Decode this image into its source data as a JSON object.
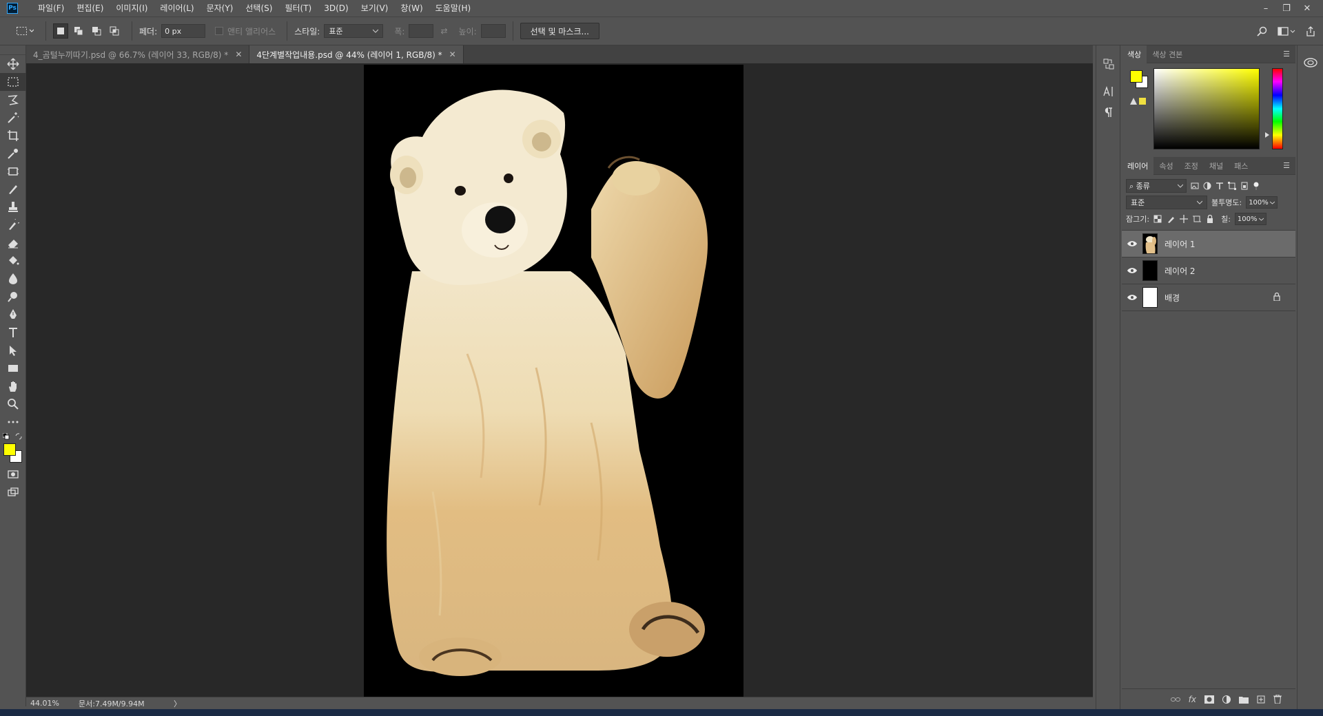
{
  "app": {
    "logo": "Ps"
  },
  "menu": [
    "파일(F)",
    "편집(E)",
    "이미지(I)",
    "레이어(L)",
    "문자(Y)",
    "선택(S)",
    "필터(T)",
    "3D(D)",
    "보기(V)",
    "창(W)",
    "도움말(H)"
  ],
  "window_controls": {
    "minimize": "–",
    "restore": "❐",
    "close": "✕"
  },
  "options": {
    "feather_label": "페더:",
    "feather_value": "0 px",
    "antialias_label": "앤티 앨리어스",
    "style_label": "스타일:",
    "style_value": "표준",
    "width_label": "폭:",
    "height_label": "높이:",
    "select_mask_button": "선택 및 마스크..."
  },
  "tabs": [
    {
      "label": "4_곰털누끼따기.psd @ 66.7% (레이어 33, RGB/8) *",
      "active": false
    },
    {
      "label": "4단계별작업내용.psd @ 44% (레이어 1, RGB/8) *",
      "active": true
    }
  ],
  "status": {
    "zoom": "44.01%",
    "doc": "문서:7.49M/9.94M",
    "arrow": "〉"
  },
  "color_panel": {
    "tabs": [
      "색상",
      "색상 견본"
    ],
    "foreground": "#ffff00",
    "background": "#ffffff"
  },
  "layers_panel": {
    "tabs": [
      "레이어",
      "속성",
      "조정",
      "채널",
      "패스"
    ],
    "filter_label": "종류",
    "blend_mode": "표준",
    "opacity_label": "불투명도:",
    "opacity_value": "100%",
    "lock_label": "잠그기:",
    "fill_label": "칠:",
    "fill_value": "100%",
    "layers": [
      {
        "name": "레이어 1",
        "selected": true,
        "thumb": "bear",
        "locked": false
      },
      {
        "name": "레이어 2",
        "selected": false,
        "thumb": "#000000",
        "locked": false
      },
      {
        "name": "배경",
        "selected": false,
        "thumb": "#ffffff",
        "locked": true
      }
    ]
  }
}
